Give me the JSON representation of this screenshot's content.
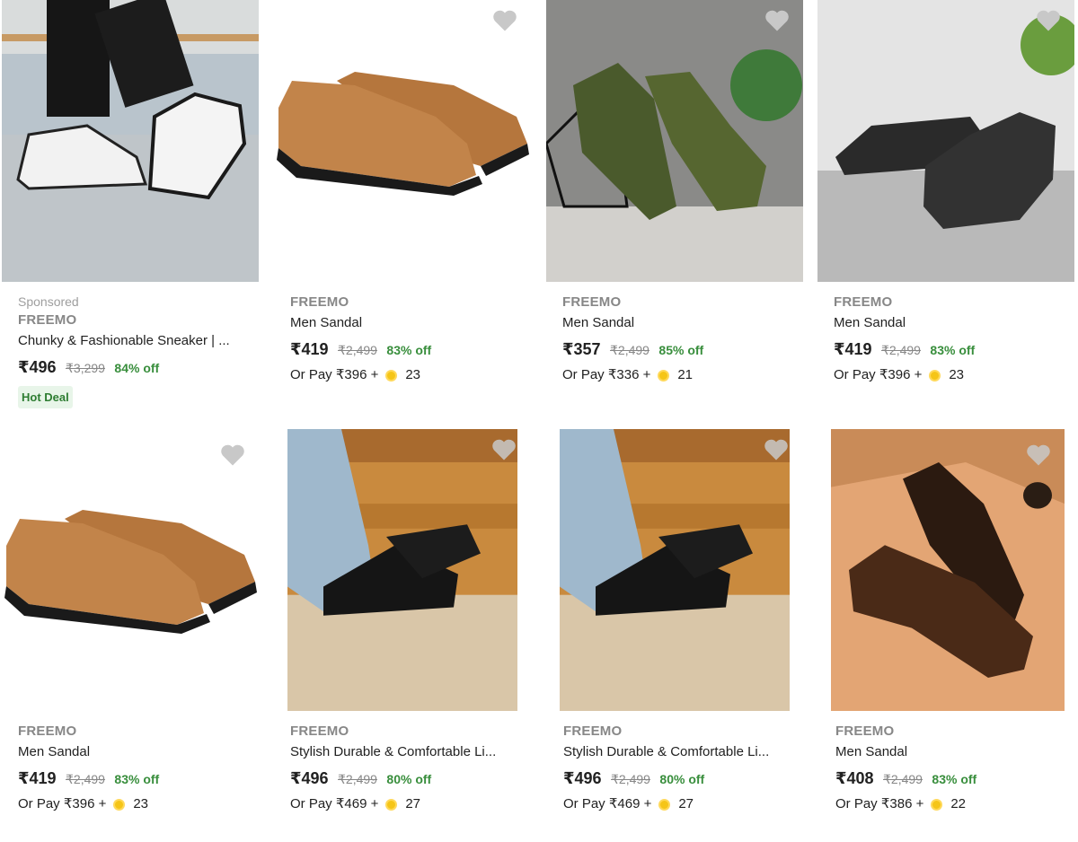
{
  "products": [
    {
      "sponsored": "Sponsored",
      "brand": "FREEMO",
      "title": "Chunky & Fashionable Sneaker | ...",
      "price": "₹496",
      "mrp": "₹3,299",
      "discount": "84% off",
      "badge": "Hot Deal"
    },
    {
      "brand": "FREEMO",
      "title": "Men Sandal",
      "price": "₹419",
      "mrp": "₹2,499",
      "discount": "83% off",
      "pay_text": "Or Pay ₹396 +",
      "coins": "23"
    },
    {
      "brand": "FREEMO",
      "title": "Men Sandal",
      "price": "₹357",
      "mrp": "₹2,499",
      "discount": "85% off",
      "pay_text": "Or Pay ₹336 +",
      "coins": "21"
    },
    {
      "brand": "FREEMO",
      "title": "Men Sandal",
      "price": "₹419",
      "mrp": "₹2,499",
      "discount": "83% off",
      "pay_text": "Or Pay ₹396 +",
      "coins": "23"
    },
    {
      "brand": "FREEMO",
      "title": "Men Sandal",
      "price": "₹419",
      "mrp": "₹2,499",
      "discount": "83% off",
      "pay_text": "Or Pay ₹396 +",
      "coins": "23"
    },
    {
      "brand": "FREEMO",
      "title": "Stylish Durable & Comfortable Li...",
      "price": "₹496",
      "mrp": "₹2,499",
      "discount": "80% off",
      "pay_text": "Or Pay ₹469 +",
      "coins": "27"
    },
    {
      "brand": "FREEMO",
      "title": "Stylish Durable & Comfortable Li...",
      "price": "₹496",
      "mrp": "₹2,499",
      "discount": "80% off",
      "pay_text": "Or Pay ₹469 +",
      "coins": "27"
    },
    {
      "brand": "FREEMO",
      "title": "Men Sandal",
      "price": "₹408",
      "mrp": "₹2,499",
      "discount": "83% off",
      "pay_text": "Or Pay ₹386 +",
      "coins": "22"
    }
  ],
  "colors": {
    "discount": "#388e3c",
    "muted": "#878787",
    "coin": "#f5c518",
    "wishlist": "#c8c8c8"
  }
}
